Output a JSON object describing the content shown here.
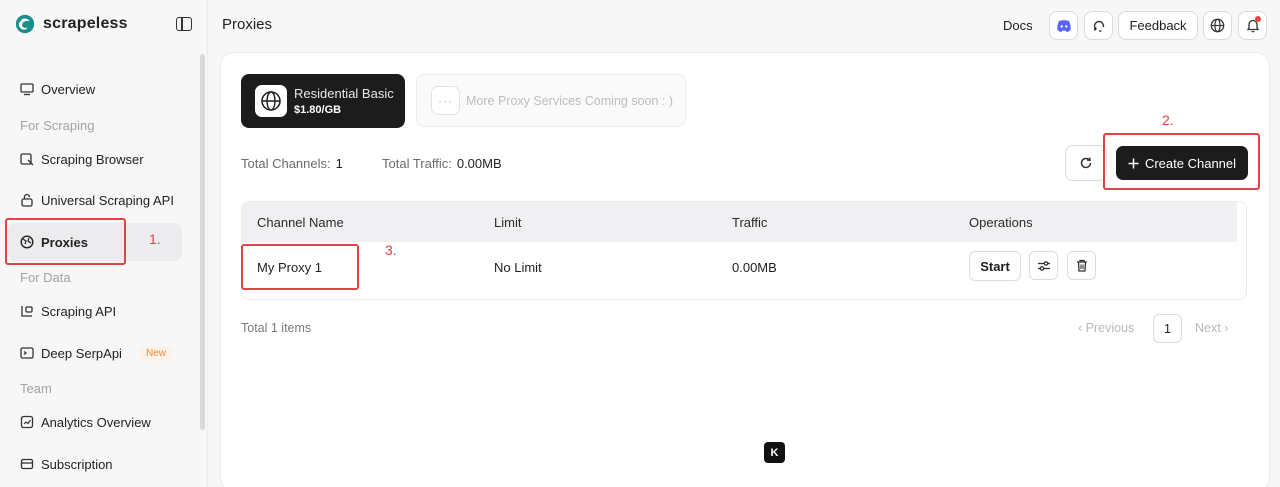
{
  "brand": {
    "name": "scrapeless"
  },
  "sidebar": {
    "items": [
      {
        "label": "Overview",
        "icon": "monitor-icon"
      },
      {
        "label": "Scraping Browser",
        "icon": "browser-icon"
      },
      {
        "label": "Universal Scraping API",
        "icon": "lock-icon"
      },
      {
        "label": "Proxies",
        "icon": "globe-icon"
      },
      {
        "label": "Scraping API",
        "icon": "api-icon"
      },
      {
        "label": "Deep SerpApi",
        "icon": "terminal-icon",
        "badge": "New"
      },
      {
        "label": "Analytics Overview",
        "icon": "analytics-icon"
      },
      {
        "label": "Subscription",
        "icon": "subscription-icon"
      }
    ],
    "sections": [
      "For Scraping",
      "For Data",
      "Team"
    ]
  },
  "header": {
    "title": "Proxies",
    "docs": "Docs",
    "feedback": "Feedback"
  },
  "services": {
    "active": {
      "name": "Residential Basic",
      "price": "$1.80/GB"
    },
    "soon": "More Proxy Services Coming soon : )"
  },
  "stats": {
    "channels_label": "Total Channels:",
    "channels_value": "1",
    "traffic_label": "Total Traffic:",
    "traffic_value": "0.00MB"
  },
  "actions": {
    "create": "Create Channel"
  },
  "table": {
    "columns": [
      "Channel Name",
      "Limit",
      "Traffic",
      "Operations"
    ],
    "rows": [
      {
        "name": "My Proxy 1",
        "limit": "No Limit",
        "traffic": "0.00MB",
        "start": "Start"
      }
    ]
  },
  "pagination": {
    "total": "Total 1 items",
    "previous": "Previous",
    "page": "1",
    "next": "Next"
  },
  "annotations": [
    "1.",
    "2.",
    "3."
  ],
  "floating": {
    "label": "K"
  },
  "colors": {
    "accent": "#1c1c1c",
    "annotation": "#e04444",
    "new_badge": "#f08a46"
  }
}
